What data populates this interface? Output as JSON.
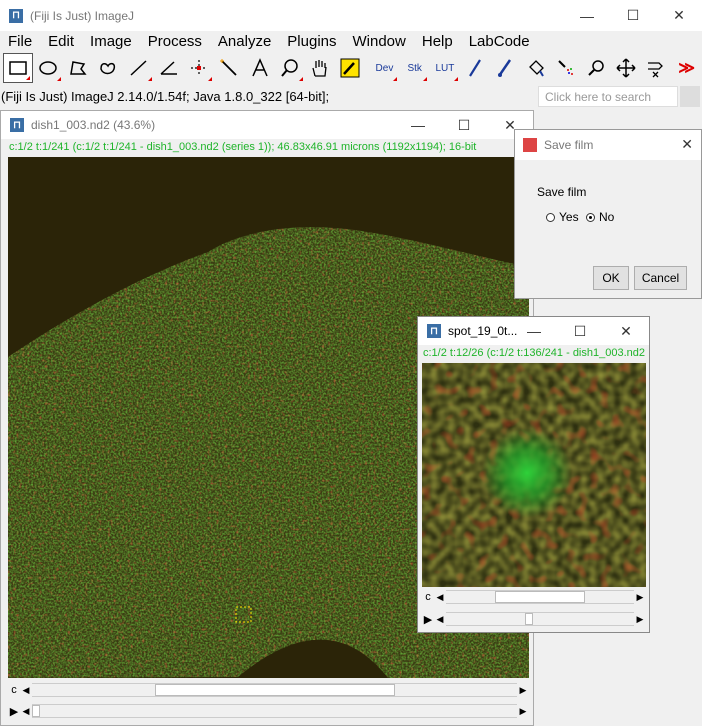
{
  "main": {
    "title": "(Fiji Is Just) ImageJ",
    "menus": [
      "File",
      "Edit",
      "Image",
      "Process",
      "Analyze",
      "Plugins",
      "Window",
      "Help",
      "LabCode"
    ],
    "tools": [
      {
        "name": "rectangle-tool-icon",
        "selected": true
      },
      {
        "name": "oval-tool-icon"
      },
      {
        "name": "polygon-tool-icon"
      },
      {
        "name": "freehand-tool-icon"
      },
      {
        "name": "line-tool-icon"
      },
      {
        "name": "angle-tool-icon"
      },
      {
        "name": "point-tool-icon"
      },
      {
        "name": "wand-tool-icon"
      },
      {
        "name": "text-tool-icon"
      },
      {
        "name": "magnifier-tool-icon"
      },
      {
        "name": "hand-tool-icon"
      },
      {
        "name": "color-picker-tool-icon"
      },
      {
        "name": "dev-tool",
        "label": "Dev"
      },
      {
        "name": "stk-tool",
        "label": "Stk"
      },
      {
        "name": "lut-tool",
        "label": "LUT"
      },
      {
        "name": "pencil-tool-icon"
      },
      {
        "name": "brush-tool-icon"
      },
      {
        "name": "flood-fill-tool-icon"
      },
      {
        "name": "spray-tool-icon"
      },
      {
        "name": "zoom-tool-icon"
      },
      {
        "name": "move-tool-icon"
      },
      {
        "name": "shortcut-tool-icon"
      },
      {
        "name": "more-tools-icon"
      }
    ],
    "status": "(Fiji Is Just) ImageJ 2.14.0/1.54f; Java 1.8.0_322 [64-bit];",
    "search_placeholder": "Click here to search"
  },
  "image_window": {
    "title": "dish1_003.nd2 (43.6%)",
    "info": "c:1/2 t:1/241 (c:1/2 t:1/241 - dish1_003.nd2 (series 1)); 46.83x46.91 microns (1192x1194); 16-bit",
    "scroll_c_label": "c",
    "c_fraction": 0.5,
    "t_fraction": 0.004
  },
  "save_dialog": {
    "title": "Save film",
    "label": "Save film",
    "options": [
      "Yes",
      "No"
    ],
    "selected": "No",
    "ok": "OK",
    "cancel": "Cancel"
  },
  "spot_window": {
    "title": "spot_19_0t...",
    "info": "c:1/2 t:12/26 (c:1/2 t:136/241 - dish1_003.nd2",
    "scroll_c_label": "c",
    "c_fraction": 0.5,
    "t_fraction": 0.44
  }
}
